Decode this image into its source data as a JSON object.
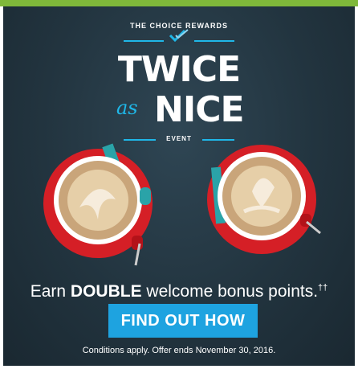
{
  "brand": {
    "program_name": "THE CHOICE REWARDS"
  },
  "headline": {
    "line1": "TWICE",
    "connector": "as",
    "line2": "NICE",
    "subtitle": "EVENT"
  },
  "offer": {
    "prefix": "Earn",
    "emphasis": "DOUBLE",
    "suffix": "welcome bonus points.",
    "footnote_mark": "††"
  },
  "cta": {
    "label": "FIND OUT HOW"
  },
  "disclaimer": "Conditions apply. Offer ends November 30, 2016.",
  "colors": {
    "accent": "#1fb7e8",
    "button": "#1ea3e0",
    "frame": "#7fb83a",
    "saucer": "#d51f26",
    "background": "#22343f"
  },
  "icons": [
    "check-logo-icon",
    "coffee-cup-icon"
  ]
}
